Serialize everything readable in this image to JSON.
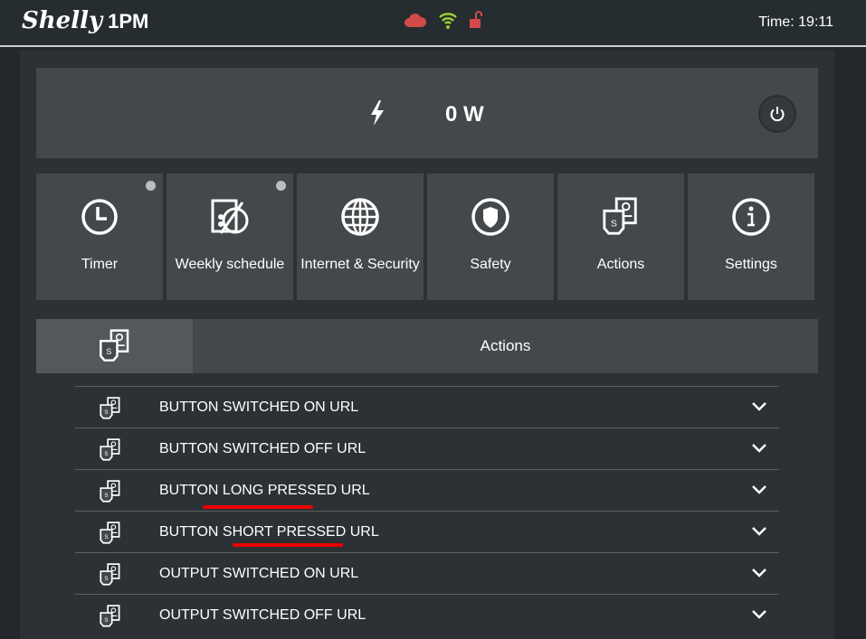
{
  "header": {
    "logo": "Shelly",
    "model": "1PM",
    "time": "Time: 19:11"
  },
  "status_icons": {
    "cloud": "cloud-icon",
    "wifi": "wifi-icon",
    "lock": "unlock-icon",
    "cloud_color": "#d24a4a",
    "wifi_color": "#9acd32",
    "lock_color": "#d24a4a"
  },
  "power": {
    "value": "0 W"
  },
  "tiles": [
    {
      "label": "Timer"
    },
    {
      "label": "Weekly schedule"
    },
    {
      "label": "Internet & Security"
    },
    {
      "label": "Safety"
    },
    {
      "label": "Actions"
    },
    {
      "label": "Settings"
    }
  ],
  "section": {
    "title": "Actions"
  },
  "actions": [
    {
      "label": "BUTTON SWITCHED ON URL"
    },
    {
      "label": "BUTTON SWITCHED OFF URL"
    },
    {
      "label": "BUTTON LONG PRESSED URL"
    },
    {
      "label": "BUTTON SHORT PRESSED URL"
    },
    {
      "label": "OUTPUT SWITCHED ON URL"
    },
    {
      "label": "OUTPUT SWITCHED OFF URL"
    }
  ]
}
